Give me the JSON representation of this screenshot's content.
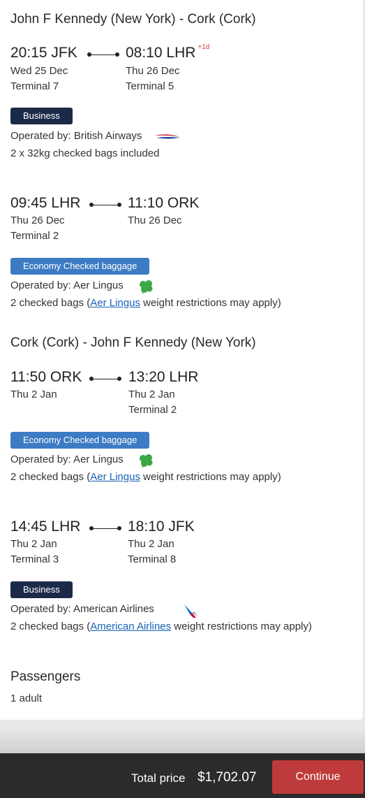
{
  "outbound": {
    "title": "John F Kennedy (New York) - Cork (Cork)",
    "segments": [
      {
        "dep_time": "20:15 JFK",
        "arr_time": "08:10 LHR",
        "arr_offset": "+1d",
        "dep_date": "Wed 25 Dec",
        "arr_date": "Thu 26 Dec",
        "dep_terminal": "Terminal 7",
        "arr_terminal": "Terminal 5",
        "cabin": "Business",
        "operated_by": "Operated by: British Airways",
        "bags": "2 x 32kg checked bags included"
      },
      {
        "dep_time": "09:45 LHR",
        "arr_time": "11:10 ORK",
        "dep_date": "Thu 26 Dec",
        "arr_date": "Thu 26 Dec",
        "dep_terminal": "Terminal 2",
        "cabin": "Economy Checked baggage",
        "operated_by": "Operated by: Aer Lingus",
        "bags_prefix": "2 checked bags (",
        "bags_link": "Aer Lingus",
        "bags_suffix": " weight restrictions may apply)"
      }
    ]
  },
  "inbound": {
    "title": "Cork (Cork) - John F Kennedy (New York)",
    "segments": [
      {
        "dep_time": "11:50 ORK",
        "arr_time": "13:20 LHR",
        "dep_date": "Thu 2 Jan",
        "arr_date": "Thu 2 Jan",
        "arr_terminal": "Terminal 2",
        "cabin": "Economy Checked baggage",
        "operated_by": "Operated by: Aer Lingus",
        "bags_prefix": "2 checked bags (",
        "bags_link": "Aer Lingus",
        "bags_suffix": " weight restrictions may apply)"
      },
      {
        "dep_time": "14:45 LHR",
        "arr_time": "18:10 JFK",
        "dep_date": "Thu 2 Jan",
        "arr_date": "Thu 2 Jan",
        "dep_terminal": "Terminal 3",
        "arr_terminal": "Terminal 8",
        "cabin": "Business",
        "operated_by": "Operated by: American Airlines",
        "bags_prefix": "2 checked bags (",
        "bags_link": "American Airlines",
        "bags_suffix": " weight restrictions may apply)"
      }
    ]
  },
  "passengers": {
    "title": "Passengers",
    "count": "1 adult"
  },
  "footer": {
    "total_label": "Total price",
    "total_value": "$1,702.07",
    "continue_label": "Continue"
  },
  "colors": {
    "business_badge": "#1c2a49",
    "economy_badge": "#3d7cc4",
    "continue_button": "#bf3a3a",
    "plus_day": "#d9413f",
    "link": "#1a63b8"
  },
  "icons": {
    "british_airways": "british-airways-logo-icon",
    "aer_lingus": "shamrock-icon",
    "american_airlines": "american-airlines-logo-icon"
  }
}
